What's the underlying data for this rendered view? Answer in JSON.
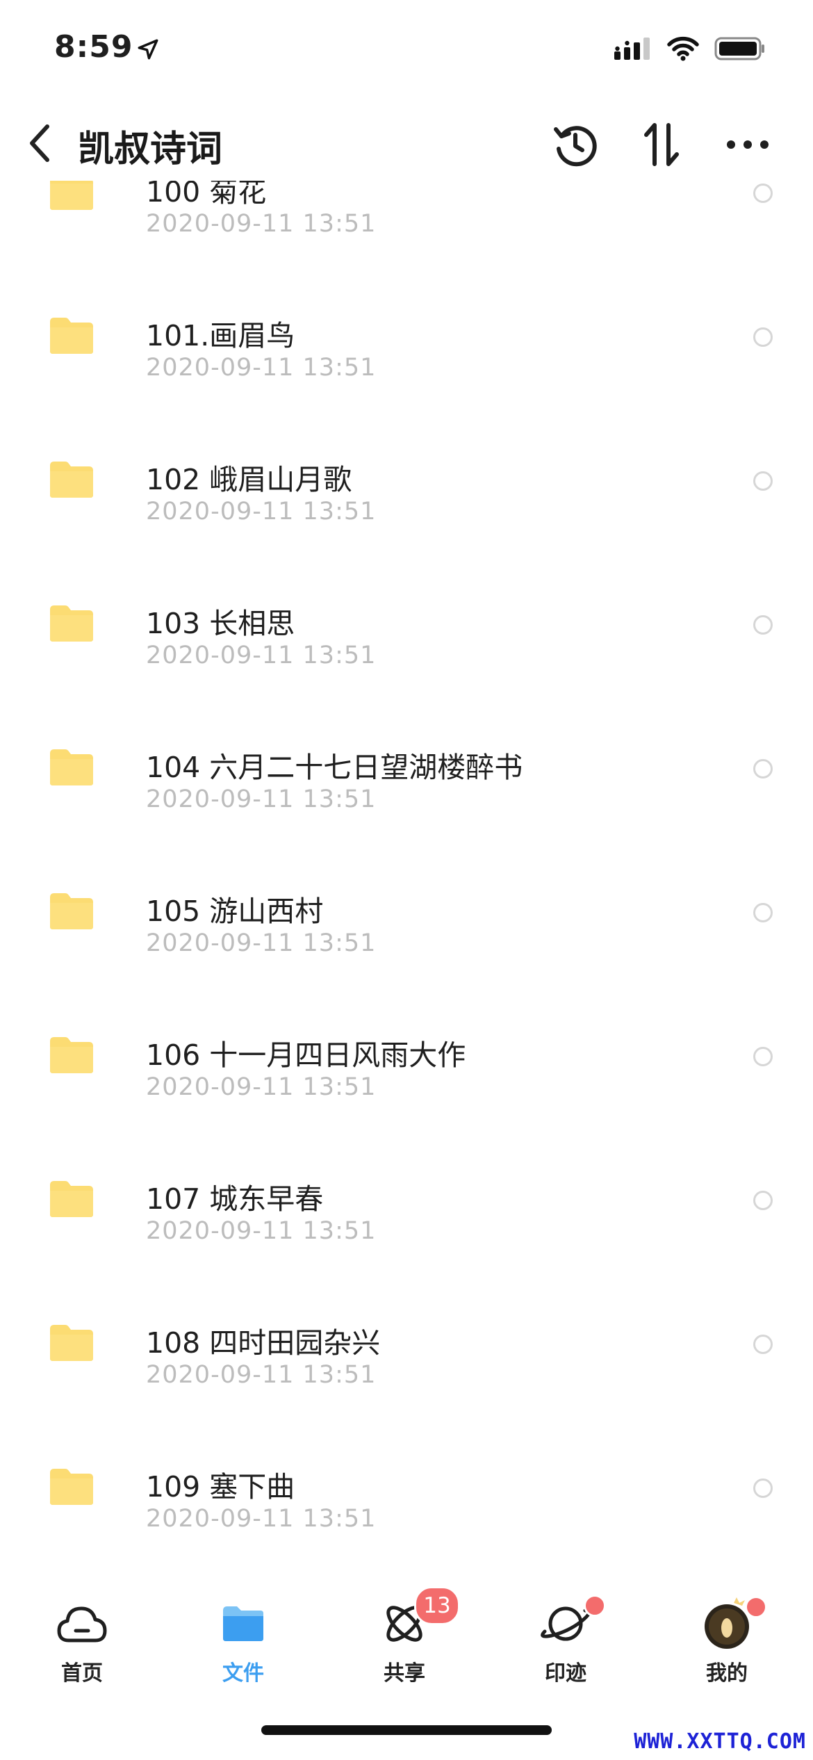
{
  "status": {
    "time": "8:59"
  },
  "header": {
    "title": "凯叔诗词"
  },
  "files": [
    {
      "name": "100 菊花",
      "date": "2020-09-11 13:51"
    },
    {
      "name": "101.画眉鸟",
      "date": "2020-09-11 13:51"
    },
    {
      "name": "102 峨眉山月歌",
      "date": "2020-09-11 13:51"
    },
    {
      "name": "103 长相思",
      "date": "2020-09-11 13:51"
    },
    {
      "name": "104 六月二十七日望湖楼醉书",
      "date": "2020-09-11 13:51"
    },
    {
      "name": "105 游山西村",
      "date": "2020-09-11 13:51"
    },
    {
      "name": "106 十一月四日风雨大作",
      "date": "2020-09-11 13:51"
    },
    {
      "name": "107 城东早春",
      "date": "2020-09-11 13:51"
    },
    {
      "name": "108 四时田园杂兴",
      "date": "2020-09-11 13:51"
    },
    {
      "name": "109 塞下曲",
      "date": "2020-09-11 13:51"
    }
  ],
  "tabs": [
    {
      "label": "首页",
      "icon": "cloud-icon"
    },
    {
      "label": "文件",
      "icon": "folder-icon",
      "active": true
    },
    {
      "label": "共享",
      "icon": "atom-icon",
      "badge": "13"
    },
    {
      "label": "印迹",
      "icon": "planet-icon",
      "dot": true
    },
    {
      "label": "我的",
      "icon": "avatar",
      "dot": true
    }
  ],
  "watermark": "WWW.XXTTQ.COM",
  "colors": {
    "accent": "#3c9ef0",
    "folder": "#fcdc73",
    "badge": "#f36c6c",
    "date": "#bcbcbc",
    "watermark": "#1d22d6"
  }
}
